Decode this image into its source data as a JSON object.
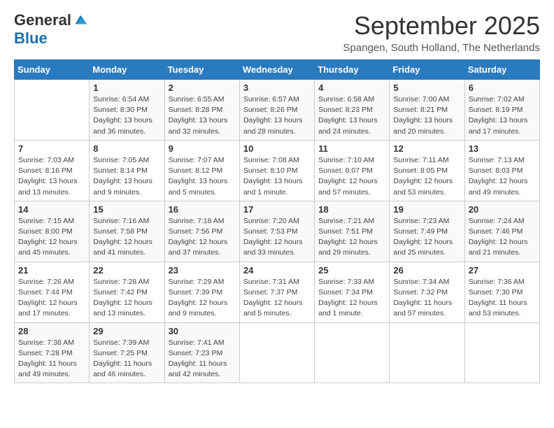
{
  "header": {
    "logo_general": "General",
    "logo_blue": "Blue",
    "month_title": "September 2025",
    "location": "Spangen, South Holland, The Netherlands"
  },
  "days_of_week": [
    "Sunday",
    "Monday",
    "Tuesday",
    "Wednesday",
    "Thursday",
    "Friday",
    "Saturday"
  ],
  "weeks": [
    [
      {
        "num": "",
        "info": ""
      },
      {
        "num": "1",
        "info": "Sunrise: 6:54 AM\nSunset: 8:30 PM\nDaylight: 13 hours and 36 minutes."
      },
      {
        "num": "2",
        "info": "Sunrise: 6:55 AM\nSunset: 8:28 PM\nDaylight: 13 hours and 32 minutes."
      },
      {
        "num": "3",
        "info": "Sunrise: 6:57 AM\nSunset: 8:26 PM\nDaylight: 13 hours and 28 minutes."
      },
      {
        "num": "4",
        "info": "Sunrise: 6:58 AM\nSunset: 8:23 PM\nDaylight: 13 hours and 24 minutes."
      },
      {
        "num": "5",
        "info": "Sunrise: 7:00 AM\nSunset: 8:21 PM\nDaylight: 13 hours and 20 minutes."
      },
      {
        "num": "6",
        "info": "Sunrise: 7:02 AM\nSunset: 8:19 PM\nDaylight: 13 hours and 17 minutes."
      }
    ],
    [
      {
        "num": "7",
        "info": "Sunrise: 7:03 AM\nSunset: 8:16 PM\nDaylight: 13 hours and 13 minutes."
      },
      {
        "num": "8",
        "info": "Sunrise: 7:05 AM\nSunset: 8:14 PM\nDaylight: 13 hours and 9 minutes."
      },
      {
        "num": "9",
        "info": "Sunrise: 7:07 AM\nSunset: 8:12 PM\nDaylight: 13 hours and 5 minutes."
      },
      {
        "num": "10",
        "info": "Sunrise: 7:08 AM\nSunset: 8:10 PM\nDaylight: 13 hours and 1 minute."
      },
      {
        "num": "11",
        "info": "Sunrise: 7:10 AM\nSunset: 8:07 PM\nDaylight: 12 hours and 57 minutes."
      },
      {
        "num": "12",
        "info": "Sunrise: 7:11 AM\nSunset: 8:05 PM\nDaylight: 12 hours and 53 minutes."
      },
      {
        "num": "13",
        "info": "Sunrise: 7:13 AM\nSunset: 8:03 PM\nDaylight: 12 hours and 49 minutes."
      }
    ],
    [
      {
        "num": "14",
        "info": "Sunrise: 7:15 AM\nSunset: 8:00 PM\nDaylight: 12 hours and 45 minutes."
      },
      {
        "num": "15",
        "info": "Sunrise: 7:16 AM\nSunset: 7:58 PM\nDaylight: 12 hours and 41 minutes."
      },
      {
        "num": "16",
        "info": "Sunrise: 7:18 AM\nSunset: 7:56 PM\nDaylight: 12 hours and 37 minutes."
      },
      {
        "num": "17",
        "info": "Sunrise: 7:20 AM\nSunset: 7:53 PM\nDaylight: 12 hours and 33 minutes."
      },
      {
        "num": "18",
        "info": "Sunrise: 7:21 AM\nSunset: 7:51 PM\nDaylight: 12 hours and 29 minutes."
      },
      {
        "num": "19",
        "info": "Sunrise: 7:23 AM\nSunset: 7:49 PM\nDaylight: 12 hours and 25 minutes."
      },
      {
        "num": "20",
        "info": "Sunrise: 7:24 AM\nSunset: 7:46 PM\nDaylight: 12 hours and 21 minutes."
      }
    ],
    [
      {
        "num": "21",
        "info": "Sunrise: 7:26 AM\nSunset: 7:44 PM\nDaylight: 12 hours and 17 minutes."
      },
      {
        "num": "22",
        "info": "Sunrise: 7:28 AM\nSunset: 7:42 PM\nDaylight: 12 hours and 13 minutes."
      },
      {
        "num": "23",
        "info": "Sunrise: 7:29 AM\nSunset: 7:39 PM\nDaylight: 12 hours and 9 minutes."
      },
      {
        "num": "24",
        "info": "Sunrise: 7:31 AM\nSunset: 7:37 PM\nDaylight: 12 hours and 5 minutes."
      },
      {
        "num": "25",
        "info": "Sunrise: 7:33 AM\nSunset: 7:34 PM\nDaylight: 12 hours and 1 minute."
      },
      {
        "num": "26",
        "info": "Sunrise: 7:34 AM\nSunset: 7:32 PM\nDaylight: 11 hours and 57 minutes."
      },
      {
        "num": "27",
        "info": "Sunrise: 7:36 AM\nSunset: 7:30 PM\nDaylight: 11 hours and 53 minutes."
      }
    ],
    [
      {
        "num": "28",
        "info": "Sunrise: 7:38 AM\nSunset: 7:28 PM\nDaylight: 11 hours and 49 minutes."
      },
      {
        "num": "29",
        "info": "Sunrise: 7:39 AM\nSunset: 7:25 PM\nDaylight: 11 hours and 46 minutes."
      },
      {
        "num": "30",
        "info": "Sunrise: 7:41 AM\nSunset: 7:23 PM\nDaylight: 11 hours and 42 minutes."
      },
      {
        "num": "",
        "info": ""
      },
      {
        "num": "",
        "info": ""
      },
      {
        "num": "",
        "info": ""
      },
      {
        "num": "",
        "info": ""
      }
    ]
  ]
}
